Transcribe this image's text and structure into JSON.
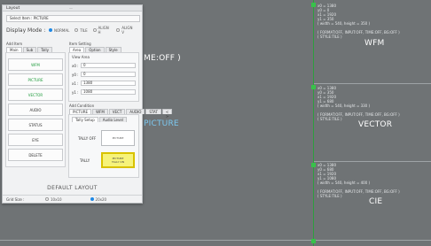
{
  "canvas": {
    "partial_label": "ME:OFF )",
    "picture_label": "PICTURE",
    "wfm": {
      "info": "x0 = 1380\ny0 = 0\nx1 = 1920\ny1 = 350\n( width = 540, height = 350 )\n\n( FORMAT:OFF, INPUT:OFF, TIME:OFF, BG:OFF )\n( STYLE:TILE )",
      "label": "WFM"
    },
    "vector": {
      "info": "x0 = 1380\ny0 = 350\nx1 = 1920\ny1 = 680\n( width = 540, height = 330 )\n\n( FORMAT:OFF, INPUT:OFF, TIME:OFF, BG:OFF )\n( STYLE:TILE )",
      "label": "VECTOR"
    },
    "cie": {
      "info": "x0 = 1380\ny0 = 680\nx1 = 1920\ny1 = 1080\n( width = 540, height = 400 )\n\n( FORMAT:OFF, INPUT:OFF, TIME:OFF, BG:OFF )\n( STYLE:TILE )",
      "label": "CIE"
    }
  },
  "panel": {
    "title": "Layout",
    "grip": "—",
    "select_item": "Select Item : PICTURE",
    "display_mode_label": "Display Mode :",
    "display_modes": [
      "NORMAL",
      "TILE",
      "ALIGN H",
      "ALIGN V"
    ],
    "add_item_label": "Add Item",
    "add_item_tabs": [
      "Main",
      "Sub",
      "Tally"
    ],
    "items": [
      "WFM",
      "PICTURE",
      "VECTOR",
      "AUDIO",
      "STATUS",
      "EYE",
      "DELETE"
    ],
    "item_setting_label": "Item Setting",
    "item_setting_tabs": [
      "Area",
      "Option",
      "Style"
    ],
    "view_area_label": "View Area",
    "fields": [
      {
        "key": "x0 :",
        "value": "0"
      },
      {
        "key": "y0 :",
        "value": "0"
      },
      {
        "key": "x1 :",
        "value": "1380"
      },
      {
        "key": "y1 :",
        "value": "1080"
      }
    ],
    "condition_label": "Add Condition",
    "condition_tabs": [
      "PICTURE",
      "WFM",
      "VECT",
      "AUDIO",
      "STAT"
    ],
    "condition_more": "< >",
    "tally_tabs": [
      "Tally Setup",
      "Audio Level"
    ],
    "tally_off_label": "TALLY OFF",
    "tally_label": "TALLY",
    "tally_off_preview": "PICTURE",
    "tally_preview_line1": "PICTURE",
    "tally_preview_line2": "TALLY ON",
    "default_layout": "DEFAULT LAYOUT",
    "grid_size_label": "Grid Size :",
    "grid_options": [
      "10x10",
      "20x20"
    ]
  }
}
